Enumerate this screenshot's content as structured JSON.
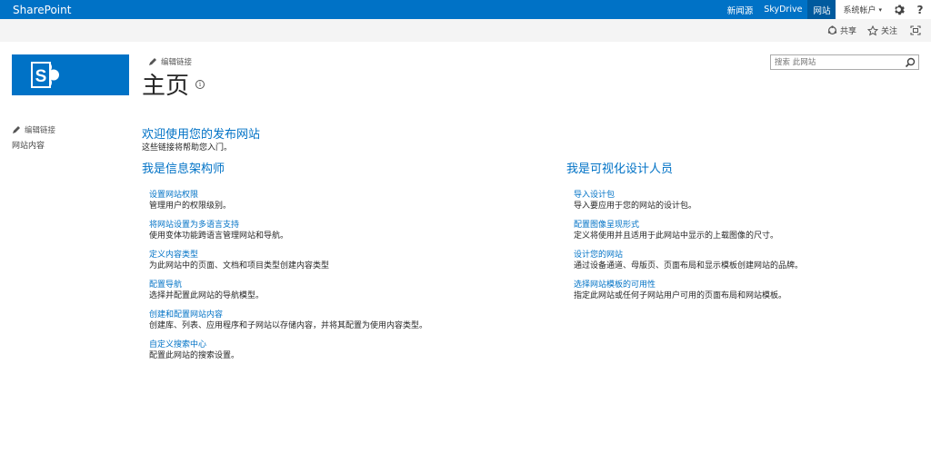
{
  "suite_bar": {
    "brand": "SharePoint",
    "links": [
      "新闻源",
      "SkyDrive",
      "网站"
    ],
    "user": "系统帐户",
    "settings_icon": "gear-icon",
    "help_icon": "help-icon",
    "color": "#0072c6"
  },
  "ribbon": {
    "share": "共享",
    "follow": "关注"
  },
  "header": {
    "edit_links": "编辑链接",
    "title": "主页",
    "search_placeholder": "搜索 此网站"
  },
  "left_nav": {
    "edit_links": "编辑链接",
    "items": [
      "网站内容"
    ]
  },
  "main": {
    "welcome_title": "欢迎使用您的发布网站",
    "welcome_sub": "这些链接将帮助您入门。",
    "left_section": {
      "heading": "我是信息架构师",
      "links": [
        {
          "title": "设置网站权限",
          "desc": "管理用户的权限级别。"
        },
        {
          "title": "将网站设置为多语言支持",
          "desc": "使用变体功能跨语言管理网站和导航。"
        },
        {
          "title": "定义内容类型",
          "desc": "为此网站中的页面、文档和项目类型创建内容类型"
        },
        {
          "title": "配置导航",
          "desc": "选择并配置此网站的导航模型。"
        },
        {
          "title": "创建和配置网站内容",
          "desc": "创建库、列表、应用程序和子网站以存储内容，并将其配置为使用内容类型。"
        },
        {
          "title": "自定义搜索中心",
          "desc": "配置此网站的搜索设置。"
        }
      ]
    },
    "right_section": {
      "heading": "我是可视化设计人员",
      "links": [
        {
          "title": "导入设计包",
          "desc": "导入要应用于您的网站的设计包。"
        },
        {
          "title": "配置图像呈现形式",
          "desc": "定义将使用并且适用于此网站中显示的上载图像的尺寸。"
        },
        {
          "title": "设计您的网站",
          "desc": "通过设备通道、母版页、页面布局和显示模板创建网站的品牌。"
        },
        {
          "title": "选择网站模板的可用性",
          "desc": "指定此网站或任何子网站用户可用的页面布局和网站模板。"
        }
      ]
    }
  }
}
